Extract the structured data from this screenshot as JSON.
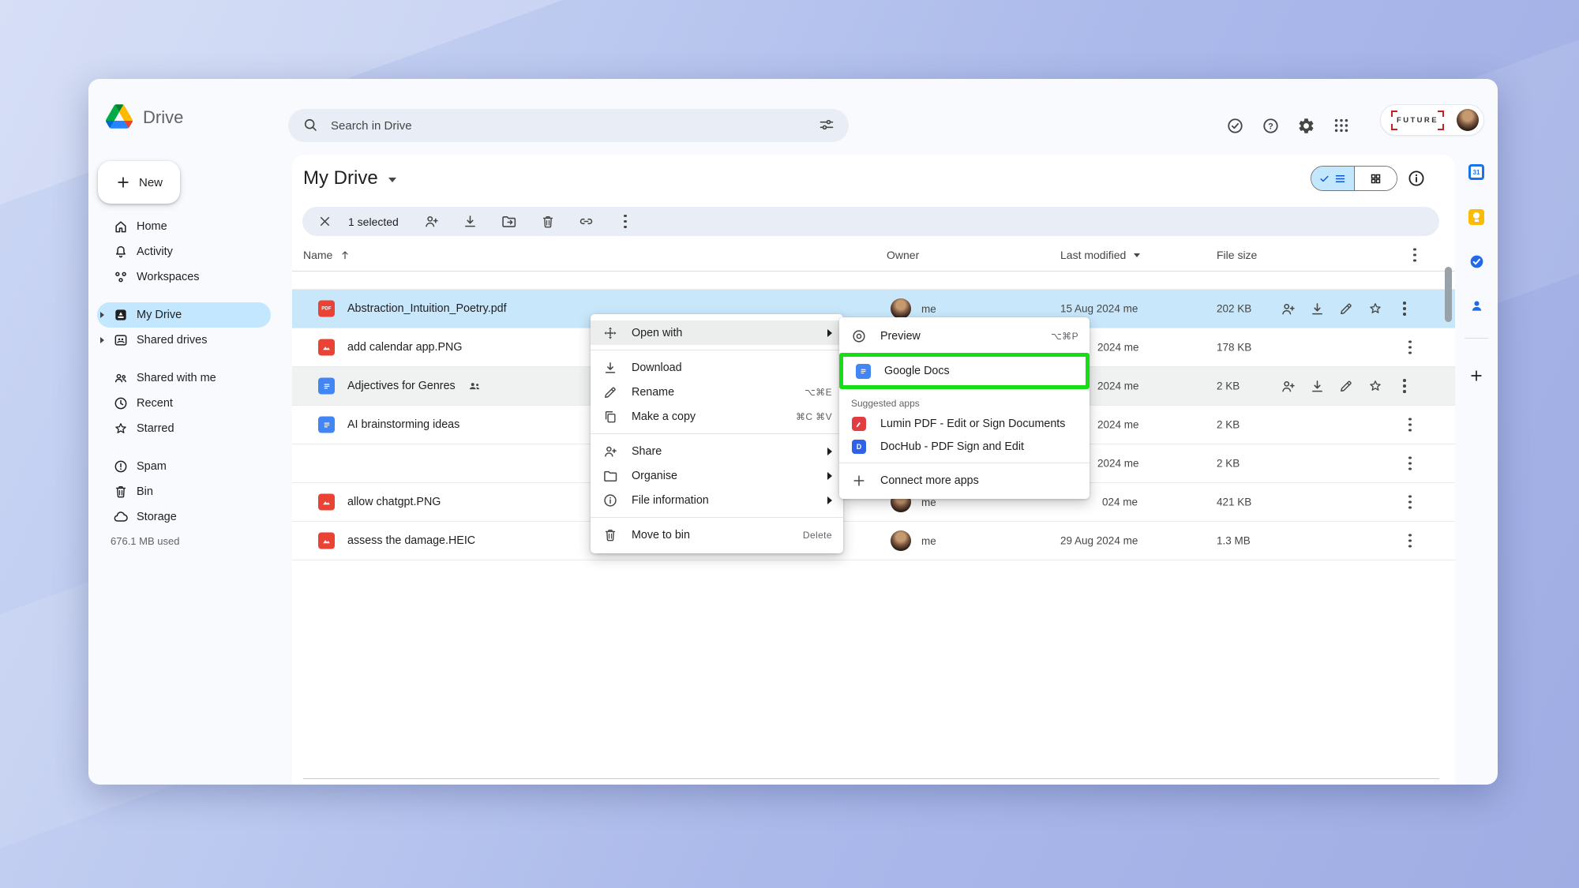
{
  "app": {
    "name": "Drive"
  },
  "topbar": {
    "search_placeholder": "Search in Drive",
    "account_brand": "FUTURE"
  },
  "icons": {
    "pdf_badge": "PDF",
    "dochub_letter": "D",
    "calendar_day": "31",
    "help_mark": "?"
  },
  "sidebar": {
    "new_label": "New",
    "items": [
      {
        "label": "Home",
        "icon": "home"
      },
      {
        "label": "Activity",
        "icon": "bell"
      },
      {
        "label": "Workspaces",
        "icon": "workspaces"
      },
      {
        "label": "My Drive",
        "icon": "my-drive",
        "selected": true,
        "expandable": true
      },
      {
        "label": "Shared drives",
        "icon": "shared-drives",
        "expandable": true
      },
      {
        "label": "Shared with me",
        "icon": "people"
      },
      {
        "label": "Recent",
        "icon": "clock"
      },
      {
        "label": "Starred",
        "icon": "star"
      },
      {
        "label": "Spam",
        "icon": "spam"
      },
      {
        "label": "Bin",
        "icon": "trash"
      },
      {
        "label": "Storage",
        "icon": "cloud"
      }
    ],
    "storage_used": "676.1 MB used"
  },
  "page": {
    "title": "My Drive",
    "selection_count": "1 selected"
  },
  "table": {
    "columns": {
      "name": "Name",
      "owner": "Owner",
      "modified": "Last modified",
      "size": "File size"
    },
    "files": [
      {
        "type": "pdf",
        "name": "Abstraction_Intuition_Poetry.pdf",
        "owner": "me",
        "modified": "15 Aug 2024 me",
        "size": "202 KB",
        "selected": true
      },
      {
        "type": "image",
        "name": "add calendar app.PNG",
        "owner": "",
        "modified": "2024 me",
        "size": "178 KB"
      },
      {
        "type": "docs",
        "name": "Adjectives for Genres",
        "shared": true,
        "owner": "",
        "modified": "2024 me",
        "size": "2 KB"
      },
      {
        "type": "docs",
        "name": "AI brainstorming ideas",
        "owner": "",
        "modified": "2024 me",
        "size": "2 KB"
      },
      {
        "type": "",
        "name": "",
        "owner": "",
        "modified": "2024 me",
        "size": "2 KB"
      },
      {
        "type": "image",
        "name": "allow chatgpt.PNG",
        "owner": "me",
        "modified": "024 me",
        "size": "421 KB"
      },
      {
        "type": "image",
        "name": "assess the damage.HEIC",
        "owner": "me",
        "modified": "29 Aug 2024 me",
        "size": "1.3 MB"
      }
    ]
  },
  "context_menu": {
    "open_with": "Open with",
    "download": "Download",
    "rename": "Rename",
    "rename_shortcut": "⌥⌘E",
    "make_a_copy": "Make a copy",
    "copy_shortcut": "⌘C ⌘V",
    "share": "Share",
    "organise": "Organise",
    "file_information": "File information",
    "move_to_bin": "Move to bin",
    "bin_shortcut": "Delete"
  },
  "submenu": {
    "preview": "Preview",
    "preview_shortcut": "⌥⌘P",
    "google_docs": "Google Docs",
    "suggested_label": "Suggested apps",
    "lumin": "Lumin PDF - Edit or Sign Documents",
    "dochub": "DocHub - PDF Sign and Edit",
    "connect": "Connect more apps"
  },
  "colors": {
    "selection_blue": "#C2E7FF",
    "hover_gray": "#F0F1F1",
    "highlight_green": "#15DE15",
    "chrome": "#F8FAFD"
  }
}
